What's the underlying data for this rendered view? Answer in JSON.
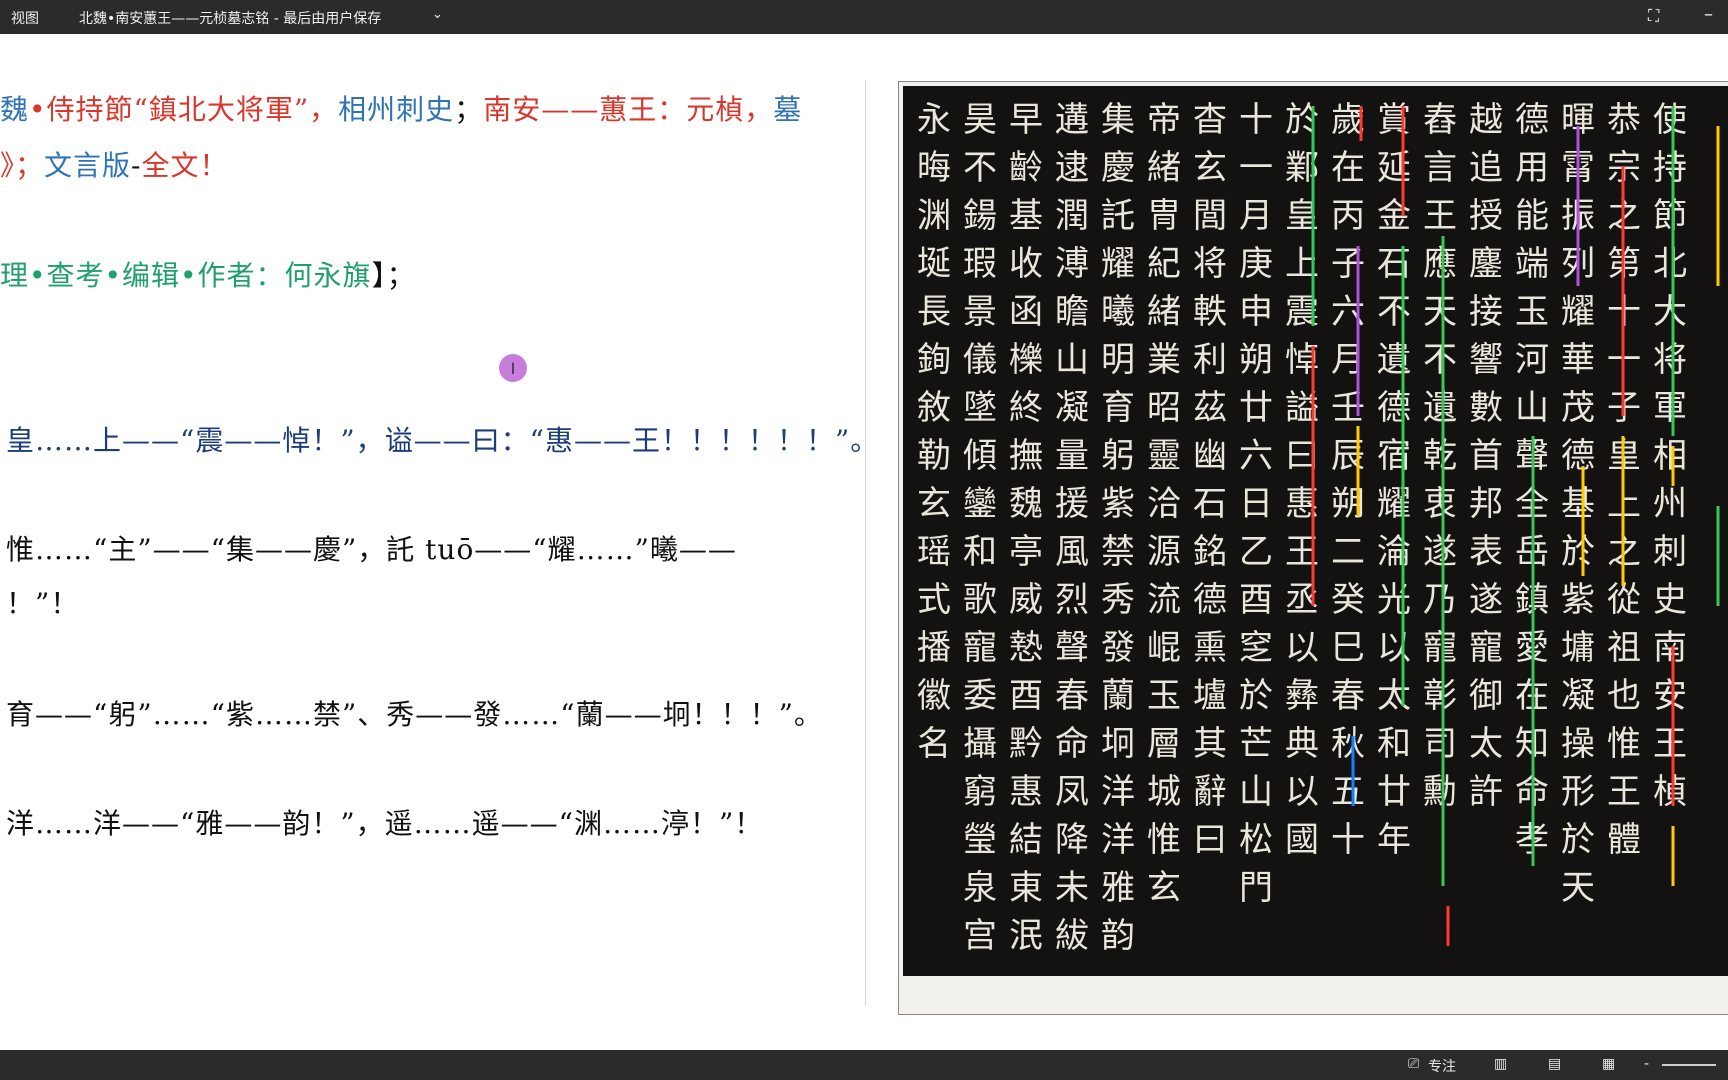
{
  "titlebar": {
    "menu_label": "视图",
    "doc_title": "北魏•南安蕙王——元桢墓志铭 - 最后由用户保存",
    "chevron_icon": "chevron-down-icon",
    "focus_icon": "fullscreen-icon",
    "minimize_icon": "minimize-icon"
  },
  "doc": {
    "line1": {
      "p1": "魏",
      "p2": "•侍持節“鎮北大将軍”，",
      "p3": "相州刺史",
      "p4": "；",
      "p5": "南安——蕙王：元楨，",
      "p6": "墓"
    },
    "line2": {
      "p1": "》；",
      "p2": "文言版",
      "p3": "-",
      "p4": "全文！"
    },
    "line3": {
      "p1": "理•查考•编辑•作者：何永旗",
      "p2": "】；"
    },
    "para1": "皇……上——“震——悼！”，谥——曰：“惠——王！！！！！！”。",
    "para2a": "惟……“主”——“集——慶”，託 tuō——“耀……”曦——",
    "para2b": "！”！",
    "para3": "育——“躬”……“紫……禁”、秀——發……“蘭——坰！！！”。",
    "para4": "洋……洋——“雅——韵！”，遥……遥——“渊……渟！”！"
  },
  "cursor": {
    "icon": "text-cursor-icon",
    "glyph": "I"
  },
  "rubbing": {
    "columns": [
      "永晦渊埏長銁敘勒玄瑶式播徽名",
      "昊不鍚瑕景儀墜傾鑾和歌寵委攝窮瑩泉宫",
      "早齡基收函櫟終撫魏亭威慹酉黔惠結東泯",
      "遘逮潤溥瞻山凝量援風烈聲春命凤降未紱",
      "集慶託耀曦明育躬紫禁秀發蘭坰洋洋雅韵",
      "帝緒冑紀緒業昭靈洽源流崐玉層城惟玄",
      "杳玄閭将軼利茲幽石銘德熏壚其辭曰",
      "十一月庚申朔廿六日乙酉窆於芒山松門",
      "於鄴皇上震悼謚曰惠王丞以彝典以國",
      "歲在丙子六月壬辰朔二癸巳春秋五十",
      "賞延金石不遺德宿耀淪光以太和廿年",
      "舂言王應天不遺乾衷遂乃寵彰司勳",
      "越追授鏖接響數首邦表遂寵御太許",
      "德用能端玉河山聲全岳鎮愛在知命孝",
      "暉霄振列耀華茂德基於紫墉凝操形於天",
      "恭宗之第十一子皇上之從祖也惟王體",
      "使持節北大将軍相州刺史南安王楨"
    ]
  },
  "statusbar": {
    "focus_label": "专注",
    "focus_icon": "focus-mode-icon",
    "read_icon": "read-mode-icon",
    "print_icon": "print-layout-icon",
    "web_icon": "web-layout-icon",
    "zoom_out": "-"
  }
}
